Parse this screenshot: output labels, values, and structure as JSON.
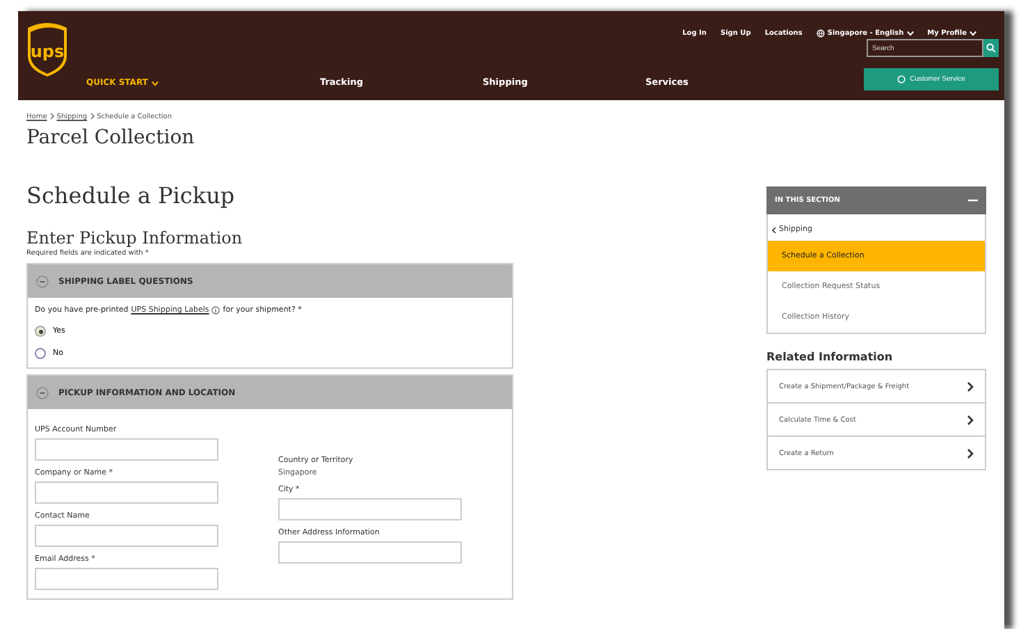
{
  "header": {
    "logo": "ups",
    "top_links": [
      "Log In",
      "Sign Up",
      "Locations"
    ],
    "locale": "Singapore - English",
    "profile": "My Profile",
    "search": {
      "placeholder": "Search"
    },
    "quick_start": "QUICK START",
    "nav": [
      "Tracking",
      "Shipping",
      "Services"
    ],
    "customer_service": "Customer Service"
  },
  "breadcrumb": [
    "Home",
    "Shipping",
    "Schedule a Collection"
  ],
  "page_title": "Parcel Collection",
  "heading": "Schedule a Pickup",
  "subheading": "Enter Pickup Information",
  "required_note": "Required fields are indicated with *",
  "sections": [
    {
      "title": "SHIPPING LABEL QUESTIONS",
      "expanded": true,
      "question": {
        "before": "Do you have pre-printed",
        "link": "UPS Shipping Labels",
        "after": "for your shipment? *"
      },
      "options": [
        {
          "label": "Yes",
          "selected": true
        },
        {
          "label": "No",
          "selected": false
        }
      ]
    },
    {
      "title": "PICKUP INFORMATION AND LOCATION",
      "expanded": true,
      "left_fields": [
        "UPS Account Number",
        "Company or Name *",
        "Contact Name",
        "Email Address *"
      ],
      "country": {
        "label": "Country or Territory",
        "value": "Singapore"
      },
      "right_fields": [
        "City *",
        "Other Address Information"
      ]
    }
  ],
  "sidebar": {
    "title": "IN THIS SECTION",
    "back": "Shipping",
    "items": [
      {
        "label": "Schedule a Collection",
        "selected": true
      },
      {
        "label": "Collection Request Status",
        "selected": false
      },
      {
        "label": "Collection History",
        "selected": false
      }
    ]
  },
  "related": {
    "title": "Related Information",
    "items": [
      "Create a Shipment/Package & Freight",
      "Calculate Time & Cost",
      "Create a Return"
    ]
  }
}
